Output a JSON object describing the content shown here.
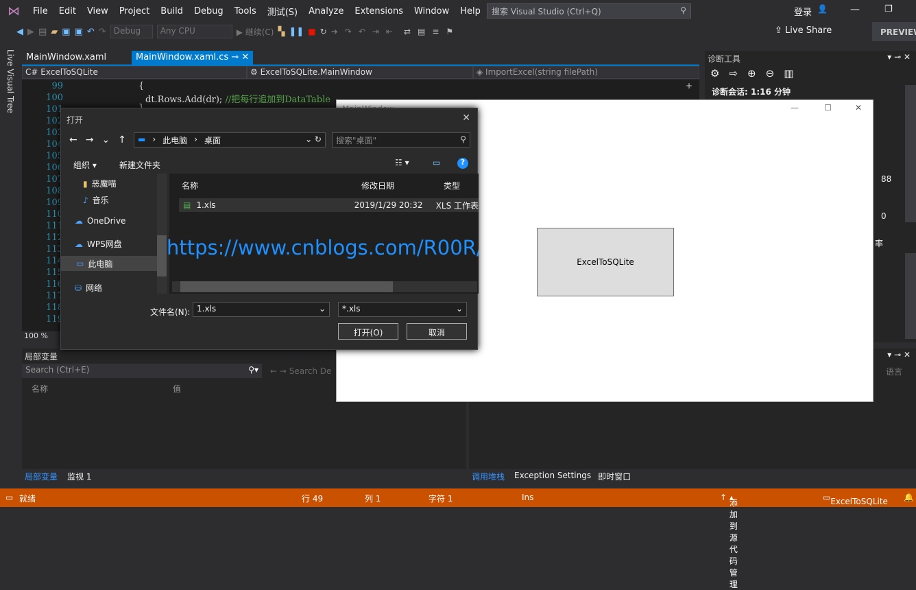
{
  "menu": [
    "File",
    "Edit",
    "View",
    "Project",
    "Build",
    "Debug",
    "Tools",
    "测试(S)",
    "Analyze",
    "Extensions",
    "Window",
    "Help"
  ],
  "search_placeholder": "搜索 Visual Studio (Ctrl+Q)",
  "login": "登录",
  "toolbar": {
    "config": "Debug",
    "platform": "Any CPU",
    "continue": "继续(C)",
    "live_share": "Live Share",
    "preview": "PREVIEW"
  },
  "live_visual_tree": "Live Visual Tree",
  "tabs": [
    {
      "label": "MainWindow.xaml"
    },
    {
      "label": "MainWindow.xaml.cs"
    }
  ],
  "nav": {
    "project": "ExcelToSQLite",
    "class": "ExcelToSQLite.MainWindow",
    "member": "ImportExcel(string filePath)"
  },
  "code": {
    "line_numbers": [
      "99",
      "100",
      "101",
      "102",
      "103",
      "104",
      "105",
      "106",
      "107",
      "108",
      "109",
      "110",
      "111",
      "112",
      "113",
      "114",
      "115",
      "116",
      "117",
      "118",
      "119"
    ],
    "line99": "{",
    "line100_code": "dt.Rows.Add(dr);",
    "line100_comment": "//把每行追加到DataTable",
    "line101": "}"
  },
  "zoom": "100 %",
  "locals": {
    "title": "局部变量",
    "search": "Search (Ctrl+E)",
    "search_depth": "Search De",
    "col_name": "名称",
    "col_value": "值",
    "tabs": [
      "局部变量",
      "监视 1"
    ]
  },
  "callstack": {
    "tabs": [
      "调用堆栈",
      "Exception Settings",
      "即时窗口"
    ],
    "col_lang": "语言"
  },
  "diag": {
    "title": "诊断工具",
    "session": "诊断会话: 1:16 分钟",
    "val_high": "88",
    "val_low": "0",
    "rate_partial": "率"
  },
  "mainwindow": {
    "title": "MainWindow",
    "button": "ExcelToSQLite"
  },
  "dialog": {
    "title": "打开",
    "path": [
      "此电脑",
      "桌面"
    ],
    "search": "搜索\"桌面\"",
    "organize": "组织",
    "new_folder": "新建文件夹",
    "nav_items": [
      "恶魔喵",
      "音乐",
      "OneDrive",
      "WPS网盘",
      "此电脑",
      "网络"
    ],
    "columns": [
      "名称",
      "修改日期",
      "类型"
    ],
    "files": [
      {
        "name": "1.xls",
        "date": "2019/1/29 20:32",
        "type": "XLS 工作表"
      }
    ],
    "watermark": "https://www.cnblogs.com/R00R/",
    "filename_label": "文件名(N):",
    "filename": "1.xls",
    "filter": "*.xls",
    "open": "打开(O)",
    "cancel": "取消"
  },
  "status": {
    "ready": "就绪",
    "line": "行 49",
    "col": "列 1",
    "char": "字符 1",
    "ins": "Ins",
    "source_control": "添加到源代码管理",
    "project": "ExcelToSQLite"
  },
  "colors": {
    "accent": "#007acc",
    "status": "#ca5100"
  }
}
